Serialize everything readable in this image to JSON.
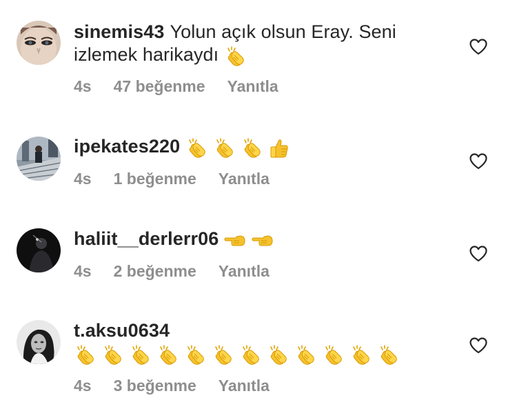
{
  "comments": [
    {
      "username": "sinemis43",
      "text": "Yolun açık olsun Eray. Seni izlemek harikaydı",
      "emojis": [
        "clap-icon"
      ],
      "time": "4s",
      "likes": "47 beğenme",
      "reply": "Yanıtla",
      "avatar": "avatar-woman-eyes"
    },
    {
      "username": "ipekates220",
      "text": "",
      "emojis": [
        "clap-icon",
        "clap-icon",
        "clap-icon",
        "thumbs-up-icon"
      ],
      "time": "4s",
      "likes": "1 beğenme",
      "reply": "Yanıtla",
      "avatar": "avatar-stairs-photo"
    },
    {
      "username": "haliit__derlerr06",
      "text": "",
      "emojis": [
        "pointing-left-icon",
        "pointing-left-icon"
      ],
      "time": "4s",
      "likes": "2 beğenme",
      "reply": "Yanıtla",
      "avatar": "avatar-dark-silhouette"
    },
    {
      "username": "t.aksu0634",
      "text": "",
      "emojis": [
        "clap-icon",
        "clap-icon",
        "clap-icon",
        "clap-icon",
        "clap-icon",
        "clap-icon",
        "clap-icon",
        "clap-icon",
        "clap-icon",
        "clap-icon",
        "clap-icon",
        "clap-icon"
      ],
      "time": "4s",
      "likes": "3 beğenme",
      "reply": "Yanıtla",
      "avatar": "avatar-woman-bw"
    }
  ],
  "colors": {
    "text": "#262626",
    "meta": "#8e8e8e",
    "emoji": "#f5c12e"
  }
}
